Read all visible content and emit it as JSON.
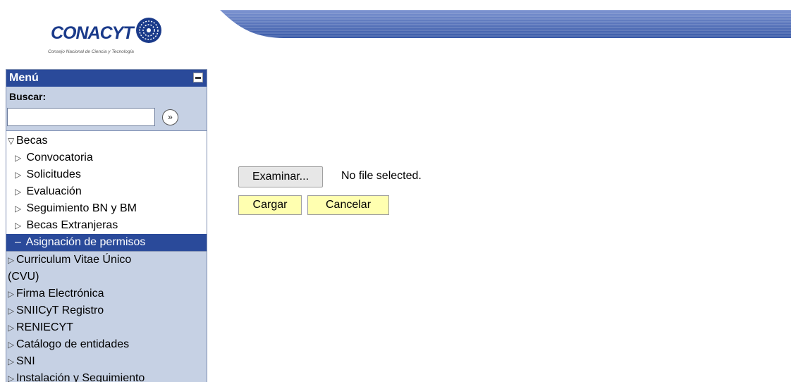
{
  "logo": {
    "name": "CONACYT",
    "tagline": "Consejo Nacional de Ciencia y Tecnología"
  },
  "menu": {
    "title": "Menú",
    "search_label": "Buscar:",
    "search_value": "",
    "go_label": "»",
    "tree": [
      {
        "label": "Becas",
        "state": "expanded",
        "children": [
          {
            "label": "Convocatoria"
          },
          {
            "label": "Solicitudes"
          },
          {
            "label": "Evaluación"
          },
          {
            "label": "Seguimiento BN y BM"
          },
          {
            "label": "Becas Extranjeras"
          },
          {
            "label": "Asignación de permisos",
            "active": true
          }
        ]
      },
      {
        "label": "Curriculum Vitae Único",
        "label2": "(CVU)"
      },
      {
        "label": "Firma Electrónica"
      },
      {
        "label": "SNIICyT Registro"
      },
      {
        "label": "RENIECYT"
      },
      {
        "label": "Catálogo de entidades"
      },
      {
        "label": "SNI"
      },
      {
        "label": "Instalación y Seguimiento"
      }
    ]
  },
  "upload": {
    "browse_label": "Examinar...",
    "file_status": "No file selected.",
    "upload_label": "Cargar",
    "cancel_label": "Cancelar"
  },
  "colors": {
    "menu_header": "#2a4a9a",
    "menu_bg": "#c6d1e4",
    "button_yellow": "#ffffb0"
  }
}
